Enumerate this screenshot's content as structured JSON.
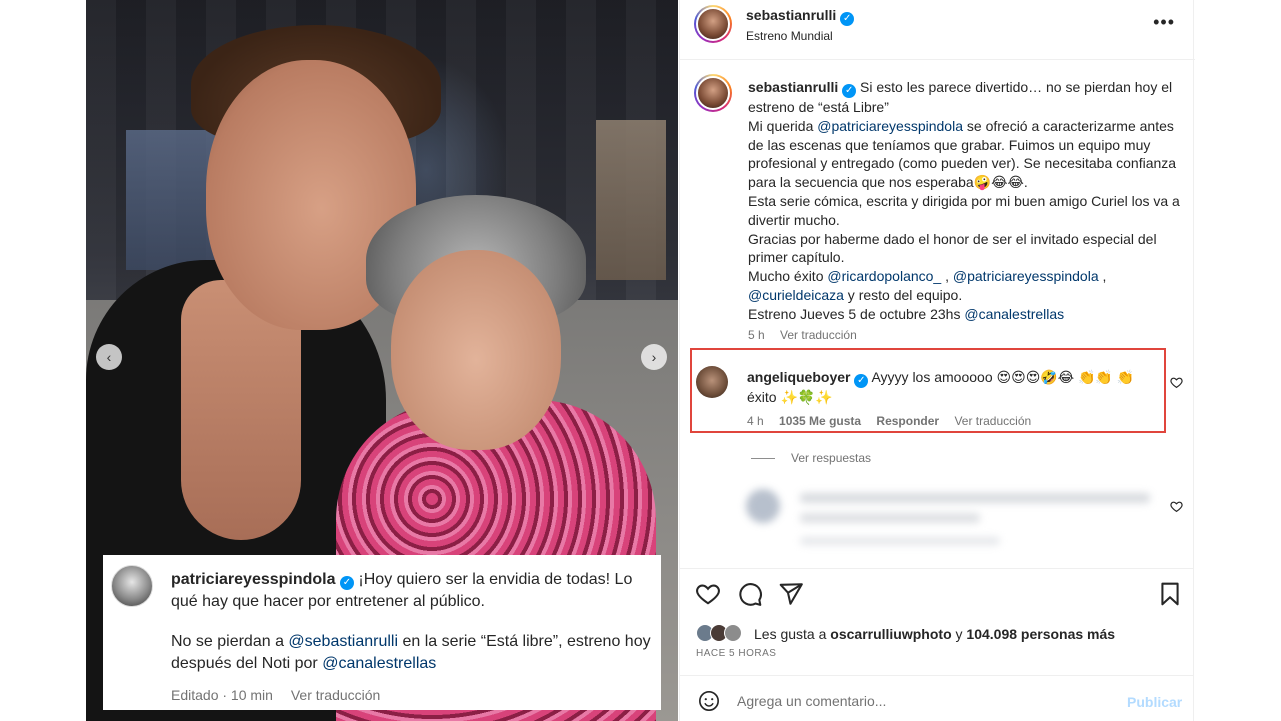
{
  "post": {
    "carousel_prev": "‹",
    "carousel_next": "›"
  },
  "overlay": {
    "username": "patriciareyesspindola",
    "text1": " ¡Hoy quiero ser la envidia de todas! Lo qué hay que hacer por entretener al público.",
    "text2_a": "No se pierdan a ",
    "text2_mention1": "@sebastianrulli",
    "text2_b": " en la serie “Está libre”, estreno hoy después del Noti por ",
    "text2_mention2": "@canalestrellas",
    "edited": "Editado · 10 min",
    "see_translation": "Ver traducción"
  },
  "header": {
    "username": "sebastianrulli",
    "subtitle": "Estreno Mundial",
    "more": "•••"
  },
  "caption": {
    "username": "sebastianrulli",
    "line1": " Si esto les parece divertido… no se pierdan hoy el estreno de “está Libre”",
    "line2_a": "Mi querida ",
    "mention_patricia": "@patriciareyesspindola",
    "line2_b": " se ofreció a caracterizarme antes de las escenas que teníamos que grabar. Fuimos un equipo muy profesional y entregado (como pueden ver). Se necesitaba confianza para la secuencia que nos esperaba🤪😂😂.",
    "line3": "Esta serie cómica, escrita y dirigida por mi buen amigo Curiel los va a divertir mucho.",
    "line4": "Gracias por haberme dado el honor de ser el invitado especial del primer capítulo.",
    "line5_a": "Mucho éxito ",
    "mention_ricardo": "@ricardopolanco_",
    "line5_sep1": " , ",
    "mention_patricia2": "@patriciareyesspindola",
    "line5_sep2": " , ",
    "mention_curiel": "@curieldeicaza",
    "line5_b": " y resto del equipo.",
    "line6_a": "Estreno Jueves 5 de octubre 23hs ",
    "mention_canal": "@canalestrellas",
    "time": "5 h",
    "see_translation": "Ver traducción"
  },
  "comment1": {
    "username": "angeliqueboyer",
    "text": " Ayyyy los amooooo 😍😍😍🤣😂 👏👏 👏 éxito ✨🍀✨",
    "time": "4 h",
    "likes": "1035 Me gusta",
    "reply": "Responder",
    "see_translation": "Ver traducción"
  },
  "replies": {
    "label": "Ver respuestas"
  },
  "likes": {
    "prefix": "Les gusta a ",
    "user": "oscarrulliuwphoto",
    "middle": " y ",
    "count": "104.098 personas más",
    "time_ago": "HACE 5 HORAS"
  },
  "composer": {
    "placeholder": "Agrega un comentario...",
    "post": "Publicar"
  },
  "colors": {
    "accent": "#0095f6",
    "highlight_border": "#e0453c",
    "mention": "#00376b",
    "muted": "#737373"
  }
}
